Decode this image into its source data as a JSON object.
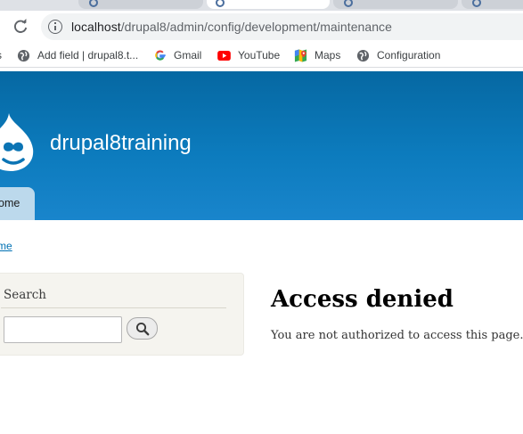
{
  "browser": {
    "address": {
      "host": "localhost",
      "path": "/drupal8/admin/config/development/maintenance"
    },
    "bookmarks": [
      {
        "label": "Add field | drupal8.t...",
        "icon": "globe-icon"
      },
      {
        "label": "Gmail",
        "icon": "google-g-icon"
      },
      {
        "label": "YouTube",
        "icon": "youtube-icon"
      },
      {
        "label": "Maps",
        "icon": "maps-icon"
      },
      {
        "label": "Configuration",
        "icon": "globe-icon"
      }
    ]
  },
  "site": {
    "name": "drupal8training",
    "nav_tab": "ome",
    "breadcrumb": "me"
  },
  "sidebar": {
    "block_title": "Search",
    "search_value": ""
  },
  "main": {
    "title": "Access denied",
    "message": "You are not authorized to access this page."
  },
  "colors": {
    "header_top": "#0668a2",
    "header_bottom": "#1985cc",
    "link": "#0071b3",
    "nav_tab_bg": "#bcd9ec",
    "sidebar_bg": "#f5f4ef"
  }
}
